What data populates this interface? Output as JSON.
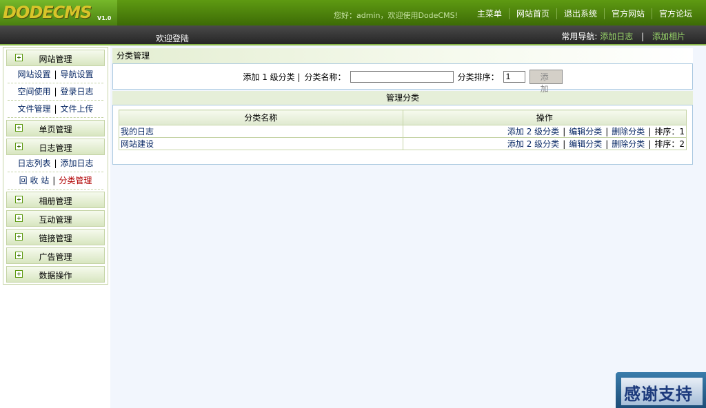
{
  "header": {
    "logo": "DODECMS",
    "version": "V1.0",
    "greeting": "您好：admin，欢迎使用DodeCMS!",
    "nav": [
      "主菜单",
      "网站首页",
      "退出系统",
      "官方网站",
      "官方论坛"
    ]
  },
  "subbar": {
    "welcome": "欢迎登陆",
    "quicknav_label": "常用导航:",
    "quick_links": [
      "添加日志",
      "添加相片"
    ],
    "separator": "|"
  },
  "sidebar": {
    "site": {
      "label": "网站管理",
      "rows": [
        [
          "网站设置",
          "导航设置"
        ],
        [
          "空间使用",
          "登录日志"
        ],
        [
          "文件管理",
          "文件上传"
        ]
      ]
    },
    "single_page": {
      "label": "单页管理"
    },
    "log": {
      "label": "日志管理",
      "rows": [
        [
          "日志列表",
          "添加日志"
        ],
        [
          "回 收 站",
          "分类管理"
        ]
      ]
    },
    "album": {
      "label": "相册管理"
    },
    "interact": {
      "label": "互动管理"
    },
    "link": {
      "label": "链接管理"
    },
    "ad": {
      "label": "广告管理"
    },
    "data": {
      "label": "数据操作"
    },
    "pipe": "|"
  },
  "main": {
    "title": "分类管理",
    "form": {
      "level_text": "添加 1 级分类 |",
      "name_label": "分类名称：",
      "name_value": "",
      "order_label": "分类排序：",
      "order_value": "1",
      "submit_label": "添 加"
    },
    "manage_title": "管理分类",
    "table": {
      "headers": [
        "分类名称",
        "操作"
      ],
      "rows": [
        {
          "name": "我的日志",
          "add": "添加 2 级分类",
          "edit": "编辑分类",
          "del": "删除分类",
          "order": "排序：1"
        },
        {
          "name": "网站建设",
          "add": "添加 2 级分类",
          "edit": "编辑分类",
          "del": "删除分类",
          "order": "排序：2"
        }
      ],
      "sep": "|"
    }
  },
  "badge": {
    "text": "感谢支持"
  },
  "colors": {
    "header_green": "#4a8010",
    "dark_bar": "#262626",
    "link_green": "#9ad86a",
    "active_red": "#b00000"
  }
}
